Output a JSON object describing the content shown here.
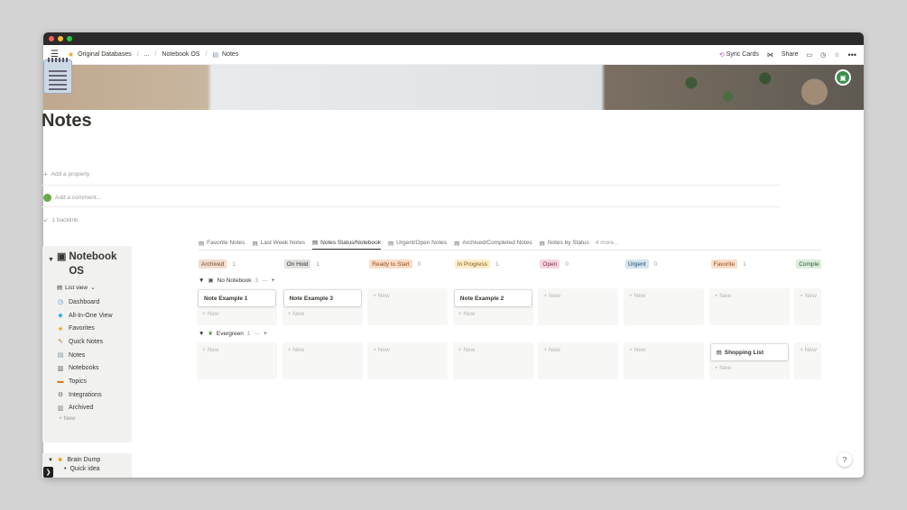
{
  "window": {
    "dot_colors": [
      "#ff5f57",
      "#febc2e",
      "#28c840"
    ]
  },
  "topbar": {
    "menu_icon": "menu-icon",
    "breadcrumb": [
      {
        "icon": "star-icon",
        "label": "Original Databases"
      },
      {
        "icon": "",
        "label": "..."
      },
      {
        "icon": "",
        "label": "Notebook OS"
      },
      {
        "icon": "notes-icon",
        "label": "Notes"
      }
    ],
    "sync_label": "Sync Cards",
    "share_label": "Share"
  },
  "page": {
    "title": "Notes",
    "add_property": "Add a property",
    "add_comment": "Add a comment...",
    "backlinks": "1 backlink"
  },
  "sidebar": {
    "title": "Notebook OS",
    "view_label": "List view",
    "items": [
      {
        "icon": "dashboard-icon",
        "label": "Dashboard"
      },
      {
        "icon": "diamond-icon",
        "label": "All-In-One View"
      },
      {
        "icon": "star-icon",
        "label": "Favorites"
      },
      {
        "icon": "quick-note-icon",
        "label": "Quick Notes"
      },
      {
        "icon": "notes-icon",
        "label": "Notes"
      },
      {
        "icon": "notebook-icon",
        "label": "Notebooks"
      },
      {
        "icon": "topics-icon",
        "label": "Topics"
      },
      {
        "icon": "gear-icon",
        "label": "Integrations"
      },
      {
        "icon": "trash-icon",
        "label": "Archived"
      }
    ],
    "new_label": "New",
    "section2_title": "Brain Dump",
    "section2_items": [
      "Quick idea"
    ]
  },
  "views": {
    "tabs": [
      {
        "label": "Favorite Notes",
        "active": false
      },
      {
        "label": "Last Week Notes",
        "active": false
      },
      {
        "label": "Notes Status/Notebook",
        "active": true
      },
      {
        "label": "Urgent/Open Notes",
        "active": false
      },
      {
        "label": "Archived/Completed Notes",
        "active": false
      },
      {
        "label": "Notes by Status",
        "active": false
      }
    ],
    "more_label": "4 more..."
  },
  "board": {
    "columns": [
      {
        "label": "Archived",
        "count": "1",
        "bg": "#f1dccd",
        "fg": "#7a4a2e"
      },
      {
        "label": "On Hold",
        "count": "1",
        "bg": "#e3e2e0",
        "fg": "#32302c"
      },
      {
        "label": "Ready to Start",
        "count": "0",
        "bg": "#fadec9",
        "fg": "#9a4a1c"
      },
      {
        "label": "In Progress",
        "count": "1",
        "bg": "#fdecc8",
        "fg": "#825a1a"
      },
      {
        "label": "Open",
        "count": "0",
        "bg": "#f5d5e0",
        "fg": "#8a2c52"
      },
      {
        "label": "Urgent",
        "count": "0",
        "bg": "#d3e5ef",
        "fg": "#244a66"
      },
      {
        "label": "Favorite",
        "count": "1",
        "bg": "#fadec9",
        "fg": "#9a4a1c"
      },
      {
        "label": "Comple",
        "count": "",
        "bg": "#dbeddb",
        "fg": "#2b5a2e"
      }
    ],
    "groups": [
      {
        "name": "No  Notebook",
        "icon": "notebook-icon",
        "count": "3",
        "cards": [
          "Note Example 1",
          "Note Example 3",
          "",
          "Note Example 2",
          "",
          "",
          "",
          ""
        ]
      },
      {
        "name": "Evergreen",
        "icon": "sprout-icon",
        "count": "1",
        "cards": [
          "",
          "",
          "",
          "",
          "",
          "",
          "Shopping List",
          ""
        ]
      }
    ],
    "new_label": "New"
  },
  "help_label": "?"
}
